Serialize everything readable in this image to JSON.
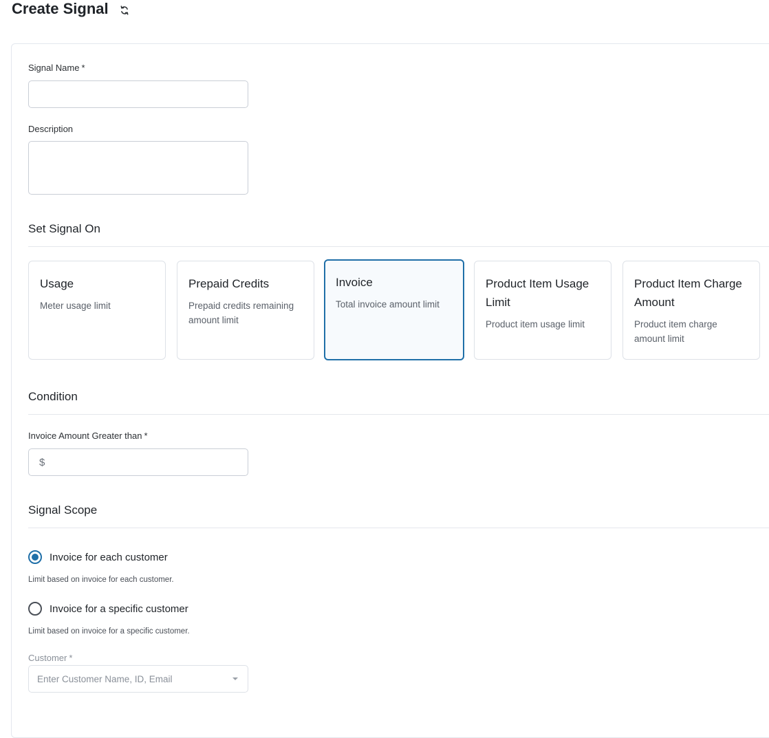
{
  "header": {
    "title": "Create Signal",
    "refresh_icon": "refresh-icon"
  },
  "form": {
    "signal_name": {
      "label": "Signal Name",
      "required_mark": "*",
      "value": "",
      "placeholder": ""
    },
    "description": {
      "label": "Description",
      "value": "",
      "placeholder": ""
    },
    "set_signal_on": {
      "title": "Set Signal On",
      "options": [
        {
          "title": "Usage",
          "description": "Meter usage limit",
          "selected": false
        },
        {
          "title": "Prepaid Credits",
          "description": "Prepaid credits remaining amount limit",
          "selected": false
        },
        {
          "title": "Invoice",
          "description": "Total invoice amount limit",
          "selected": true
        },
        {
          "title": "Product Item Usage Limit",
          "description": "Product item usage limit",
          "selected": false
        },
        {
          "title": "Product Item Charge Amount",
          "description": "Product item charge amount limit",
          "selected": false
        }
      ]
    },
    "condition": {
      "title": "Condition",
      "amount_label": "Invoice Amount Greater than",
      "required_mark": "*",
      "prefix": "$",
      "value": ""
    },
    "signal_scope": {
      "title": "Signal Scope",
      "options": [
        {
          "label": "Invoice for each customer",
          "helper": "Limit based on invoice for each customer.",
          "checked": true
        },
        {
          "label": "Invoice for a specific customer",
          "helper": "Limit based on invoice for a specific customer.",
          "checked": false
        }
      ],
      "customer": {
        "label": "Customer",
        "required_mark": "*",
        "placeholder": "Enter Customer Name, ID, Email"
      }
    }
  },
  "colors": {
    "accent": "#1f6fa8",
    "border": "#c9ced6",
    "selected_bg": "#f7fafd"
  }
}
